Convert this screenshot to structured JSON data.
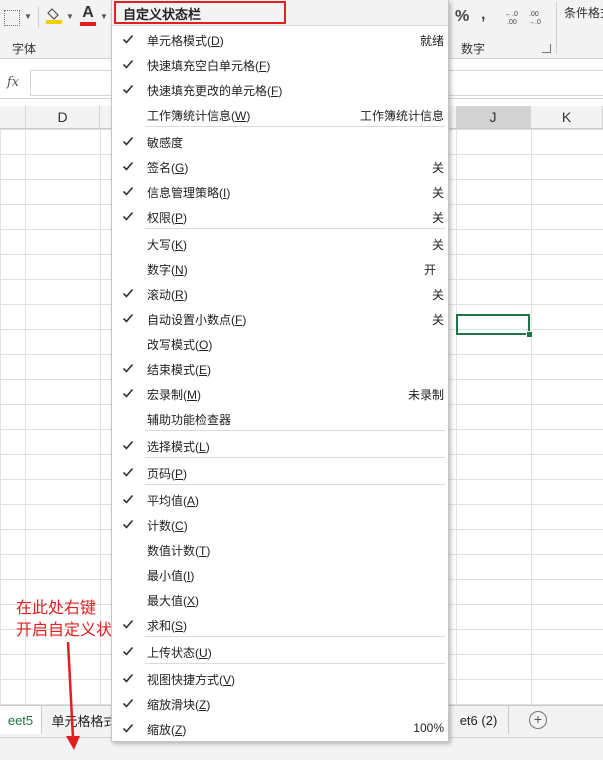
{
  "ribbon": {
    "font_group_label": "字体",
    "number_group_label": "数字",
    "percent_symbol": "%",
    "comma_symbol": ",",
    "increase_decimal_label": "←.0 .00",
    "decrease_decimal_label": ".00 →.0",
    "conditional_format_label": "条件格式"
  },
  "formula_bar": {
    "fx_label": "fx"
  },
  "columns": [
    "D",
    "J",
    "K"
  ],
  "sheet_tabs": {
    "left_tab": "eet5",
    "active_tab": "单元格格式",
    "right_tab": "et6 (2)",
    "add_symbol": "+"
  },
  "annotation": {
    "line1": "在此处右键",
    "line2": "开启自定义状态栏",
    "color": "#e02020"
  },
  "menu": {
    "title": "自定义状态栏",
    "items": [
      {
        "label": "单元格模式",
        "key": "D",
        "checked": true,
        "value": "就绪"
      },
      {
        "label": "快速填充空白单元格",
        "key": "F",
        "checked": true,
        "value": ""
      },
      {
        "label": "快速填充更改的单元格",
        "key": "F",
        "checked": true,
        "value": ""
      },
      {
        "label": "工作簿统计信息",
        "key": "W",
        "checked": false,
        "value": "工作簿统计信息"
      },
      {
        "label": "敏感度",
        "key": "",
        "checked": true,
        "value": ""
      },
      {
        "label": "签名",
        "key": "G",
        "checked": true,
        "value": "关"
      },
      {
        "label": "信息管理策略",
        "key": "I",
        "checked": true,
        "value": "关"
      },
      {
        "label": "权限",
        "key": "P",
        "checked": true,
        "value": "关"
      },
      {
        "label": "大写",
        "key": "K",
        "checked": false,
        "value": "关"
      },
      {
        "label": "数字",
        "key": "N",
        "checked": false,
        "value": "开"
      },
      {
        "label": "滚动",
        "key": "R",
        "checked": true,
        "value": "关"
      },
      {
        "label": "自动设置小数点",
        "key": "F",
        "checked": true,
        "value": "关"
      },
      {
        "label": "改写模式",
        "key": "O",
        "checked": false,
        "value": ""
      },
      {
        "label": "结束模式",
        "key": "E",
        "checked": true,
        "value": ""
      },
      {
        "label": "宏录制",
        "key": "M",
        "checked": true,
        "value": "未录制"
      },
      {
        "label": "辅助功能检查器",
        "key": "",
        "checked": false,
        "value": ""
      },
      {
        "label": "选择模式",
        "key": "L",
        "checked": true,
        "value": ""
      },
      {
        "label": "页码",
        "key": "P",
        "checked": true,
        "value": ""
      },
      {
        "label": "平均值",
        "key": "A",
        "checked": true,
        "value": ""
      },
      {
        "label": "计数",
        "key": "C",
        "checked": true,
        "value": ""
      },
      {
        "label": "数值计数",
        "key": "T",
        "checked": false,
        "value": ""
      },
      {
        "label": "最小值",
        "key": "I",
        "checked": false,
        "value": ""
      },
      {
        "label": "最大值",
        "key": "X",
        "checked": false,
        "value": ""
      },
      {
        "label": "求和",
        "key": "S",
        "checked": true,
        "value": ""
      },
      {
        "label": "上传状态",
        "key": "U",
        "checked": true,
        "value": ""
      },
      {
        "label": "视图快捷方式",
        "key": "V",
        "checked": true,
        "value": ""
      },
      {
        "label": "缩放滑块",
        "key": "Z",
        "checked": true,
        "value": ""
      },
      {
        "label": "缩放",
        "key": "Z",
        "checked": true,
        "value": "100%"
      }
    ]
  }
}
